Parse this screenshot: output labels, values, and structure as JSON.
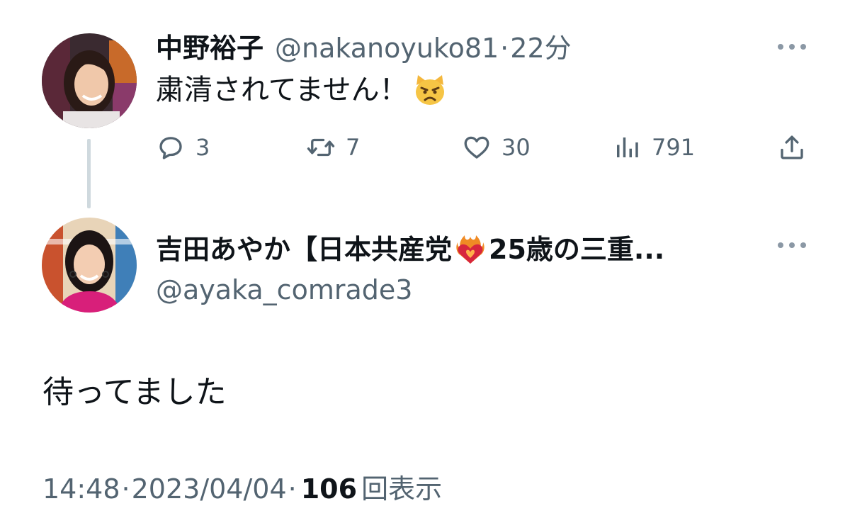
{
  "tweet1": {
    "name": "中野裕子",
    "handle": "@nakanoyuko81",
    "separator": "·",
    "time": "22分",
    "text": "粛清されてません！",
    "emoji": "pouting-cat-emoji",
    "stats": {
      "replies": "3",
      "retweets": "7",
      "likes": "30",
      "views": "791"
    }
  },
  "tweet2": {
    "name_prefix": "吉田あやか【日本共産党",
    "name_emoji": "heart-on-fire-emoji",
    "name_suffix": "25歳の三重...",
    "handle": "@ayaka_comrade3",
    "text": "待ってました",
    "time": "14:48",
    "date": "2023/04/04",
    "separator": "·",
    "views_count": "106",
    "views_label": "回表示"
  },
  "colors": {
    "text": "#0f1419",
    "secondary": "#536471",
    "thread_line": "#cfd9de"
  }
}
